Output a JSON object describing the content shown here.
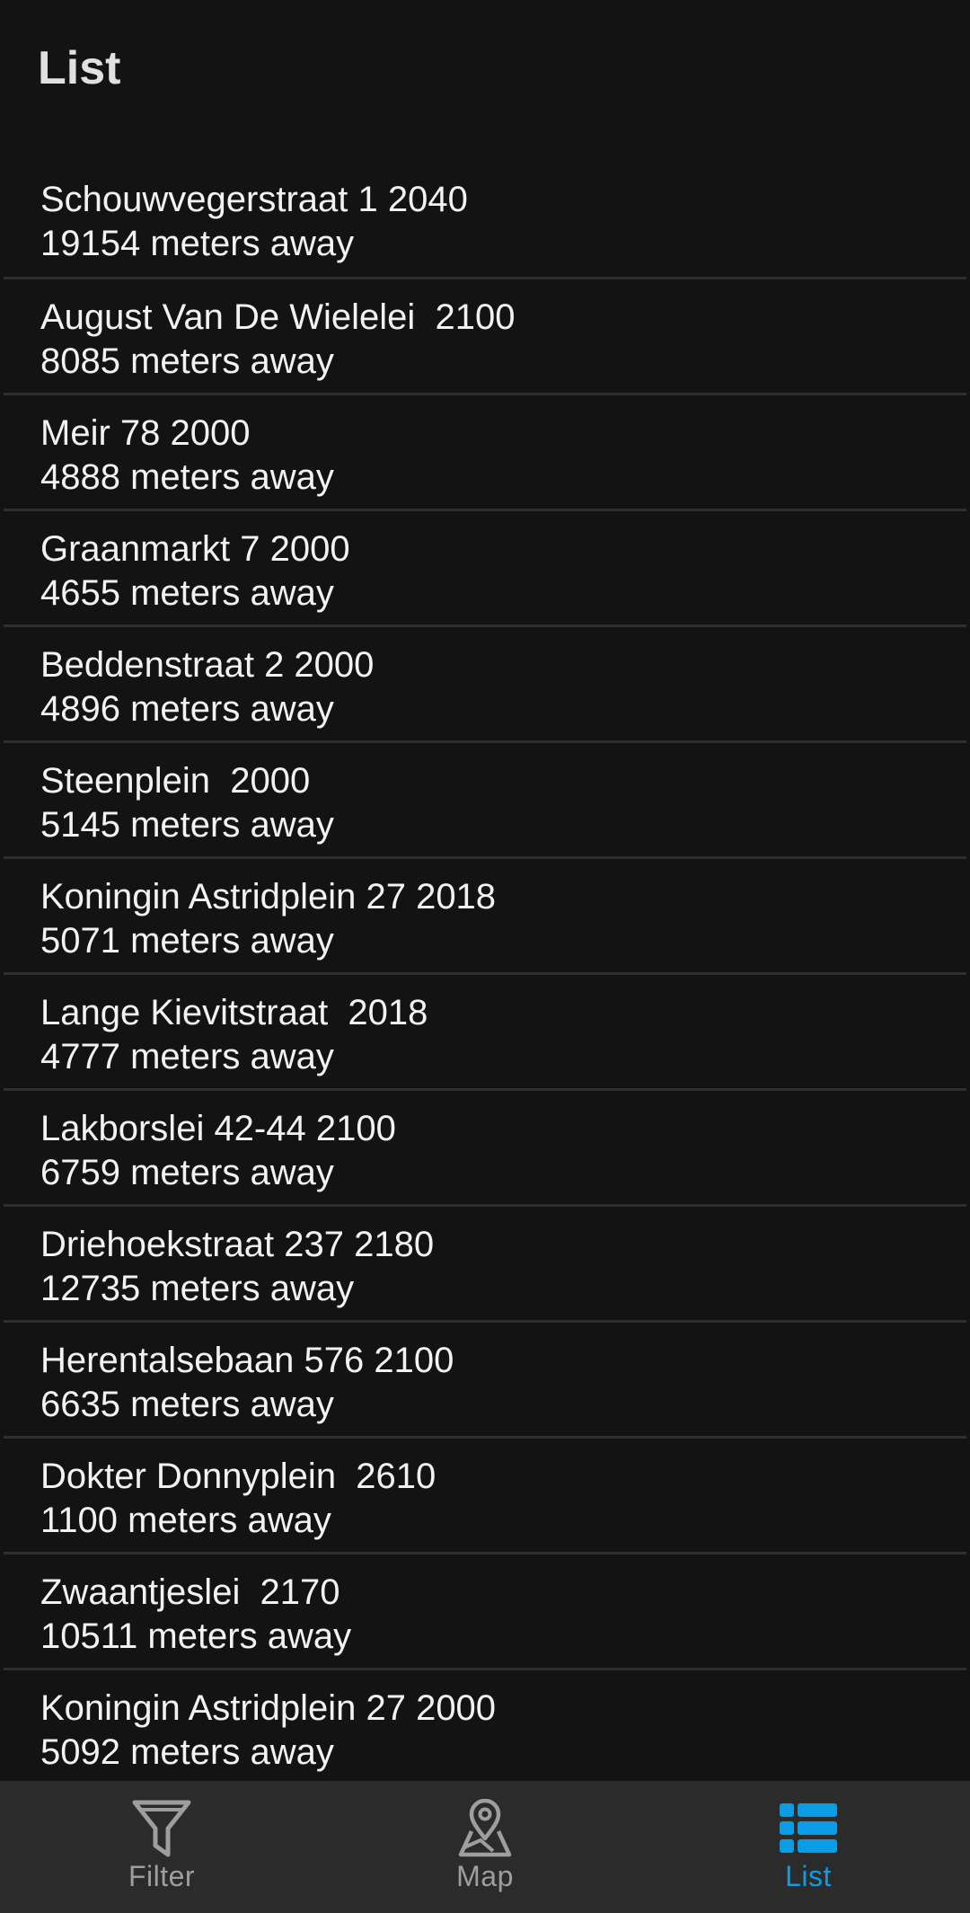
{
  "header": {
    "title": "List"
  },
  "items": [
    {
      "address": "Schouwvegerstraat 1 2040",
      "distance": "19154 meters away"
    },
    {
      "address": "August Van De Wielelei  2100",
      "distance": "8085 meters away"
    },
    {
      "address": "Meir 78 2000",
      "distance": "4888 meters away"
    },
    {
      "address": "Graanmarkt 7 2000",
      "distance": "4655 meters away"
    },
    {
      "address": "Beddenstraat 2 2000",
      "distance": "4896 meters away"
    },
    {
      "address": "Steenplein  2000",
      "distance": "5145 meters away"
    },
    {
      "address": "Koningin Astridplein 27 2018",
      "distance": "5071 meters away"
    },
    {
      "address": "Lange Kievitstraat  2018",
      "distance": "4777 meters away"
    },
    {
      "address": "Lakborslei 42-44 2100",
      "distance": "6759 meters away"
    },
    {
      "address": "Driehoekstraat 237 2180",
      "distance": "12735 meters away"
    },
    {
      "address": "Herentalsebaan 576 2100",
      "distance": "6635 meters away"
    },
    {
      "address": "Dokter Donnyplein  2610",
      "distance": "1100 meters away"
    },
    {
      "address": "Zwaantjeslei  2170",
      "distance": "10511 meters away"
    },
    {
      "address": "Koningin Astridplein 27 2000",
      "distance": "5092 meters away"
    }
  ],
  "nav": {
    "tabs": [
      {
        "label": "Filter",
        "icon": "filter-icon",
        "active": false
      },
      {
        "label": "Map",
        "icon": "map-pin-icon",
        "active": false
      },
      {
        "label": "List",
        "icon": "list-icon",
        "active": true
      }
    ],
    "active_color": "#0a9de6",
    "inactive_color": "#9e9e9e"
  },
  "colors": {
    "background": "#131313",
    "nav_background": "#2b2b2b",
    "divider": "#2f2f2f",
    "text": "#f2f2f2"
  }
}
